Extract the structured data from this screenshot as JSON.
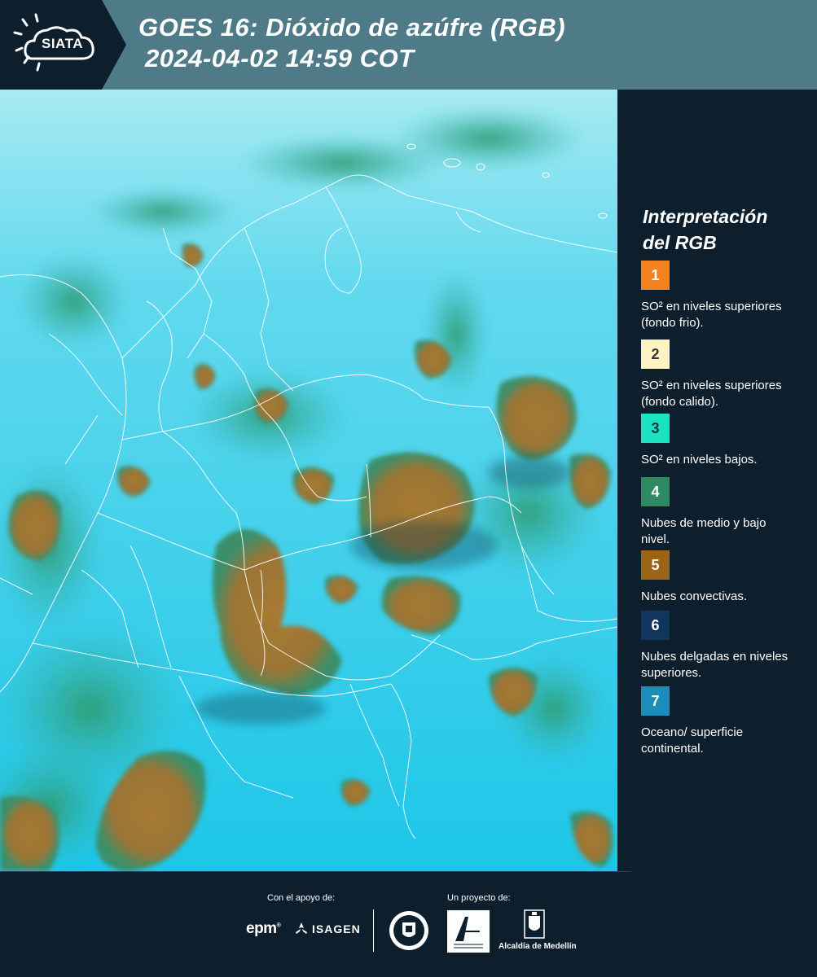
{
  "header": {
    "logo_text": "SIATA",
    "title_line1": "GOES 16: Dióxido de azúfre (RGB)",
    "title_line2": "2024-04-02 14:59 COT",
    "background_color": "#4f7a88",
    "logo_block_color": "#0d1e2c"
  },
  "map": {
    "ocean_color": "#29c8e6",
    "cloud_low_color": "#2e9a6e",
    "convective_color": "#a87a32",
    "border_color": "#ffffff"
  },
  "legend": {
    "title_line1": "Interpretación",
    "title_line2": "del RGB",
    "items": [
      {
        "number": "1",
        "text": "SO² en niveles superiores (fondo frio).",
        "color": "#f58220",
        "num_color": "#ffffff"
      },
      {
        "number": "2",
        "text": "SO² en niveles superiores (fondo calido).",
        "color": "#fff3c4",
        "num_color": "#333333"
      },
      {
        "number": "3",
        "text": "SO² en niveles bajos.",
        "color": "#1be3c0",
        "num_color": "#0d3a3a"
      },
      {
        "number": "4",
        "text": "Nubes de medio y bajo nivel.",
        "color": "#2f8a63",
        "num_color": "#ffffff"
      },
      {
        "number": "5",
        "text": "Nubes convectivas.",
        "color": "#9c6416",
        "num_color": "#ffffff"
      },
      {
        "number": "6",
        "text": "Nubes delgadas en niveles superiores.",
        "color": "#12355d",
        "num_color": "#ffffff"
      },
      {
        "number": "7",
        "text": "Oceano/ superficie continental.",
        "color": "#1b8dbb",
        "num_color": "#ffffff"
      }
    ]
  },
  "footer": {
    "support_label": "Con el apoyo de:",
    "project_label": "Un proyecto de:",
    "epm": "epm",
    "epm_mark": "®",
    "isagen": "ISAGEN",
    "alcaldia": "Alcaldía de Medellín"
  }
}
